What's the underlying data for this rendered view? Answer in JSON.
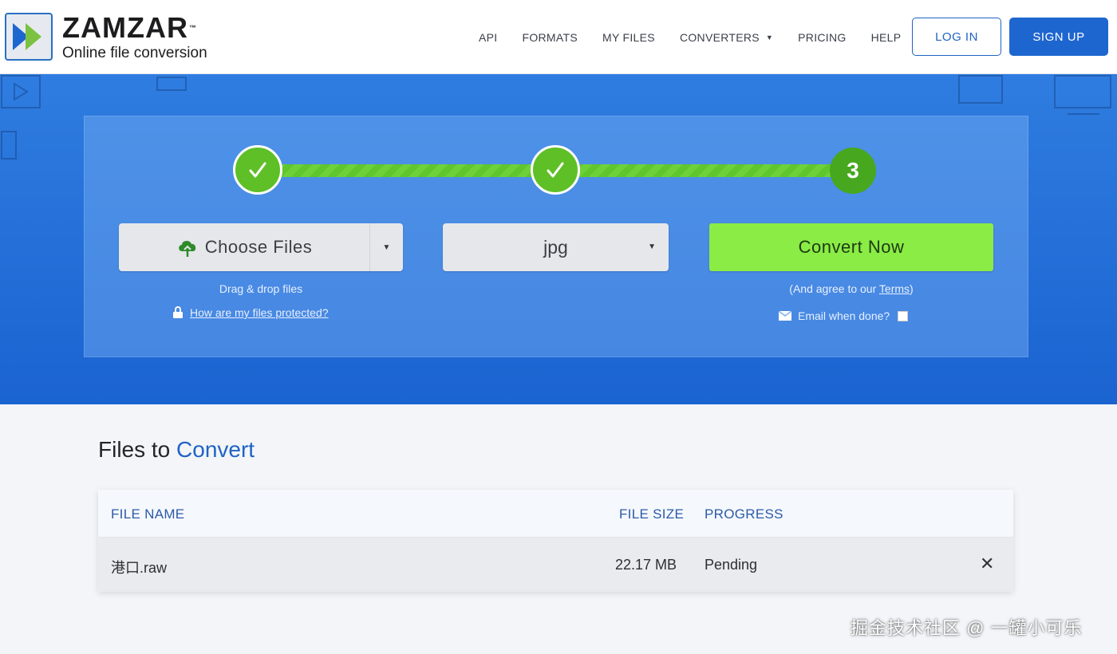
{
  "header": {
    "logo_name": "ZAMZAR",
    "logo_tm": "™",
    "logo_tagline": "Online file conversion",
    "nav": [
      {
        "label": "API"
      },
      {
        "label": "FORMATS"
      },
      {
        "label": "MY FILES"
      },
      {
        "label": "CONVERTERS"
      },
      {
        "label": "PRICING"
      },
      {
        "label": "HELP"
      }
    ],
    "login_label": "LOG IN",
    "signup_label": "SIGN UP"
  },
  "converter": {
    "step3_label": "3",
    "choose_files_label": "Choose Files",
    "format_value": "jpg",
    "convert_label": "Convert Now",
    "drag_text": "Drag & drop files",
    "protect_link": "How are my files protected?",
    "agree_prefix": "(And agree to our ",
    "agree_link": "Terms",
    "agree_suffix": ")",
    "email_label": "Email when done?"
  },
  "files": {
    "title_part1": "Files to",
    "title_part2": "Convert",
    "columns": {
      "name": "FILE NAME",
      "size": "FILE SIZE",
      "progress": "PROGRESS"
    },
    "rows": [
      {
        "name": "港口.raw",
        "size": "22.17 MB",
        "progress": "Pending"
      }
    ]
  },
  "watermark": "掘金技术社区 @ 一罐小可乐",
  "colors": {
    "brand_blue": "#1e66cf",
    "convert_green": "#8aec45",
    "step_green": "#5fbf26"
  },
  "icons": [
    "zamzar-logo-icon",
    "check-icon",
    "cloud-upload-icon",
    "chevron-down-icon",
    "lock-icon",
    "envelope-icon",
    "close-icon"
  ]
}
